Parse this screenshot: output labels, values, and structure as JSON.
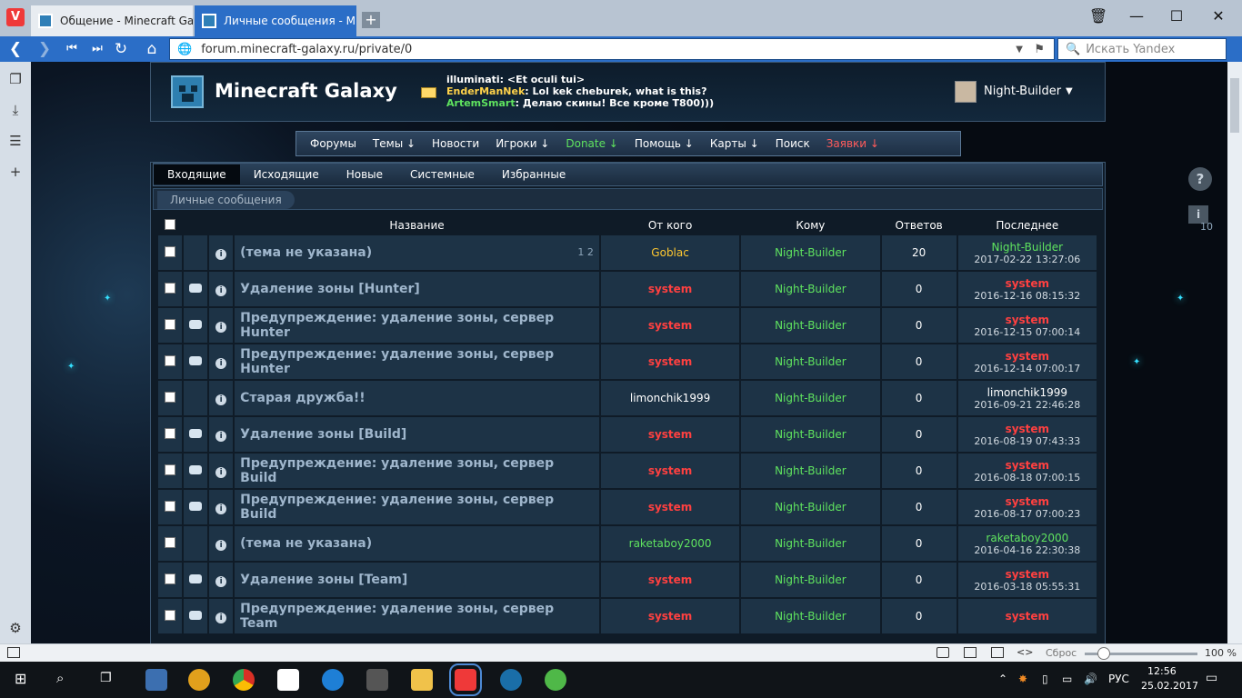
{
  "browser": {
    "tabs": [
      {
        "label": "Общение - Minecraft Galaxy",
        "active": false
      },
      {
        "label": "Личные сообщения - Minec",
        "active": true
      }
    ],
    "url": "forum.minecraft-galaxy.ru/private/0",
    "search_placeholder": "Искать Yandex",
    "accent_color": "#2b6ec7"
  },
  "site": {
    "title": "Minecraft Galaxy",
    "chat": [
      {
        "nick": "illuminati",
        "color": "#ffffff",
        "text": ": <Et oculi tui>"
      },
      {
        "nick": "EnderManNek",
        "color": "#ffd24a",
        "text": ": Lol kek cheburek, what is this?"
      },
      {
        "nick": "ArtemSmart",
        "color": "#5fe35f",
        "text": ": Делаю скины! Все кроме T800)))"
      }
    ],
    "user": {
      "name": "Night-Builder",
      "caret": "▼"
    }
  },
  "nav": [
    {
      "label": "Форумы",
      "color": "#ffffff"
    },
    {
      "label": "Темы ↓",
      "color": "#ffffff"
    },
    {
      "label": "Новости",
      "color": "#ffffff"
    },
    {
      "label": "Игроки ↓",
      "color": "#ffffff"
    },
    {
      "label": "Donate ↓",
      "color": "#5fe35f"
    },
    {
      "label": "Помощь ↓",
      "color": "#ffffff"
    },
    {
      "label": "Карты ↓",
      "color": "#ffffff"
    },
    {
      "label": "Поиск",
      "color": "#ffffff"
    },
    {
      "label": "Заявки ↓",
      "color": "#ff5b5b"
    }
  ],
  "pm": {
    "tabs": [
      "Входящие",
      "Исходящие",
      "Новые",
      "Системные",
      "Избранные"
    ],
    "selected_tab": 0,
    "breadcrumb": "Личные сообщения",
    "headers": {
      "title": "Название",
      "from": "От кого",
      "to": "Кому",
      "replies": "Ответов",
      "last": "Последнее"
    },
    "rows": [
      {
        "bubble": false,
        "title": "(тема не указана)",
        "pages": "1 2",
        "from": "Goblac",
        "from_class": "c-yellow",
        "to": "Night-Builder",
        "replies": "20",
        "last_who": "Night-Builder",
        "last_class": "c-green",
        "last_date": "2017-02-22 13:27:06"
      },
      {
        "bubble": true,
        "title": "Удаление зоны [Hunter]",
        "pages": "",
        "from": "system",
        "from_class": "c-red",
        "to": "Night-Builder",
        "replies": "0",
        "last_who": "system",
        "last_class": "c-red",
        "last_date": "2016-12-16 08:15:32"
      },
      {
        "bubble": true,
        "title": "Предупреждение: удаление зоны, сервер Hunter",
        "pages": "",
        "from": "system",
        "from_class": "c-red",
        "to": "Night-Builder",
        "replies": "0",
        "last_who": "system",
        "last_class": "c-red",
        "last_date": "2016-12-15 07:00:14"
      },
      {
        "bubble": true,
        "title": "Предупреждение: удаление зоны, сервер Hunter",
        "pages": "",
        "from": "system",
        "from_class": "c-red",
        "to": "Night-Builder",
        "replies": "0",
        "last_who": "system",
        "last_class": "c-red",
        "last_date": "2016-12-14 07:00:17"
      },
      {
        "bubble": false,
        "title": "Старая дружба!!",
        "pages": "",
        "from": "limonchik1999",
        "from_class": "c-white",
        "to": "Night-Builder",
        "replies": "0",
        "last_who": "limonchik1999",
        "last_class": "c-white",
        "last_date": "2016-09-21 22:46:28"
      },
      {
        "bubble": true,
        "title": "Удаление зоны [Build]",
        "pages": "",
        "from": "system",
        "from_class": "c-red",
        "to": "Night-Builder",
        "replies": "0",
        "last_who": "system",
        "last_class": "c-red",
        "last_date": "2016-08-19 07:43:33"
      },
      {
        "bubble": true,
        "title": "Предупреждение: удаление зоны, сервер Build",
        "pages": "",
        "from": "system",
        "from_class": "c-red",
        "to": "Night-Builder",
        "replies": "0",
        "last_who": "system",
        "last_class": "c-red",
        "last_date": "2016-08-18 07:00:15"
      },
      {
        "bubble": true,
        "title": "Предупреждение: удаление зоны, сервер Build",
        "pages": "",
        "from": "system",
        "from_class": "c-red",
        "to": "Night-Builder",
        "replies": "0",
        "last_who": "system",
        "last_class": "c-red",
        "last_date": "2016-08-17 07:00:23"
      },
      {
        "bubble": false,
        "title": "(тема не указана)",
        "pages": "",
        "from": "raketaboy2000",
        "from_class": "c-green",
        "to": "Night-Builder",
        "replies": "0",
        "last_who": "raketaboy2000",
        "last_class": "c-green",
        "last_date": "2016-04-16 22:30:38"
      },
      {
        "bubble": true,
        "title": "Удаление зоны [Team]",
        "pages": "",
        "from": "system",
        "from_class": "c-red",
        "to": "Night-Builder",
        "replies": "0",
        "last_who": "system",
        "last_class": "c-red",
        "last_date": "2016-03-18 05:55:31"
      },
      {
        "bubble": true,
        "title": "Предупреждение: удаление зоны, сервер Team",
        "pages": "",
        "from": "system",
        "from_class": "c-red",
        "to": "Night-Builder",
        "replies": "0",
        "last_who": "system",
        "last_class": "c-red",
        "last_date": ""
      }
    ]
  },
  "right_panel": {
    "help_icon": "?",
    "info_icon": "i",
    "info_count": "10"
  },
  "statusbar": {
    "reset_label": "Сброс",
    "zoom": "100 %"
  },
  "taskbar": {
    "lang": "РУС",
    "time": "12:56",
    "date": "25.02.2017"
  }
}
